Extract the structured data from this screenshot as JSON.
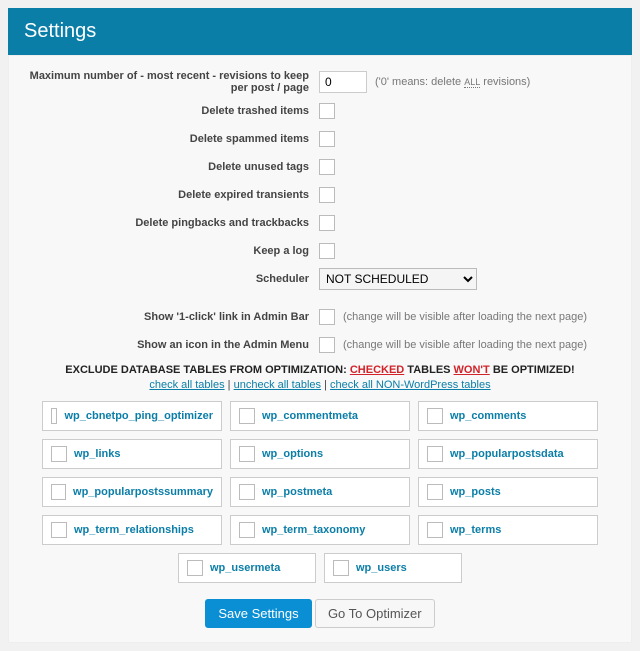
{
  "header": {
    "title": "Settings"
  },
  "options": {
    "revisions": {
      "label": "Maximum number of - most recent - revisions to keep per post / page",
      "value": "0",
      "hint_pre": "('0' means: delete ",
      "hint_all": "ALL",
      "hint_post": " revisions)"
    },
    "del_trashed": {
      "label": "Delete trashed items"
    },
    "del_spammed": {
      "label": "Delete spammed items"
    },
    "del_tags": {
      "label": "Delete unused tags"
    },
    "del_trans": {
      "label": "Delete expired transients"
    },
    "del_ping": {
      "label": "Delete pingbacks and trackbacks"
    },
    "keep_log": {
      "label": "Keep a log"
    },
    "scheduler": {
      "label": "Scheduler",
      "value": "NOT SCHEDULED"
    },
    "adminbar": {
      "label": "Show '1-click' link in Admin Bar",
      "hint": "(change will be visible after loading the next page)"
    },
    "adminmenu": {
      "label": "Show an icon in the Admin Menu",
      "hint": "(change will be visible after loading the next page)"
    }
  },
  "exclude": {
    "heading_pre": "EXCLUDE DATABASE TABLES FROM OPTIMIZATION: ",
    "checked": "CHECKED",
    "mid": " TABLES ",
    "wont": "WON'T",
    "post": " BE OPTIMIZED!",
    "links": {
      "check_all": "check all tables",
      "uncheck_all": "uncheck all tables",
      "nonwp": "check all NON-WordPress tables"
    }
  },
  "tables": [
    "wp_cbnetpo_ping_optimizer",
    "wp_commentmeta",
    "wp_comments",
    "wp_links",
    "wp_options",
    "wp_popularpostsdata",
    "wp_popularpostssummary",
    "wp_postmeta",
    "wp_posts",
    "wp_term_relationships",
    "wp_term_taxonomy",
    "wp_terms",
    "wp_usermeta",
    "wp_users"
  ],
  "buttons": {
    "save": "Save Settings",
    "goto": "Go To Optimizer"
  }
}
